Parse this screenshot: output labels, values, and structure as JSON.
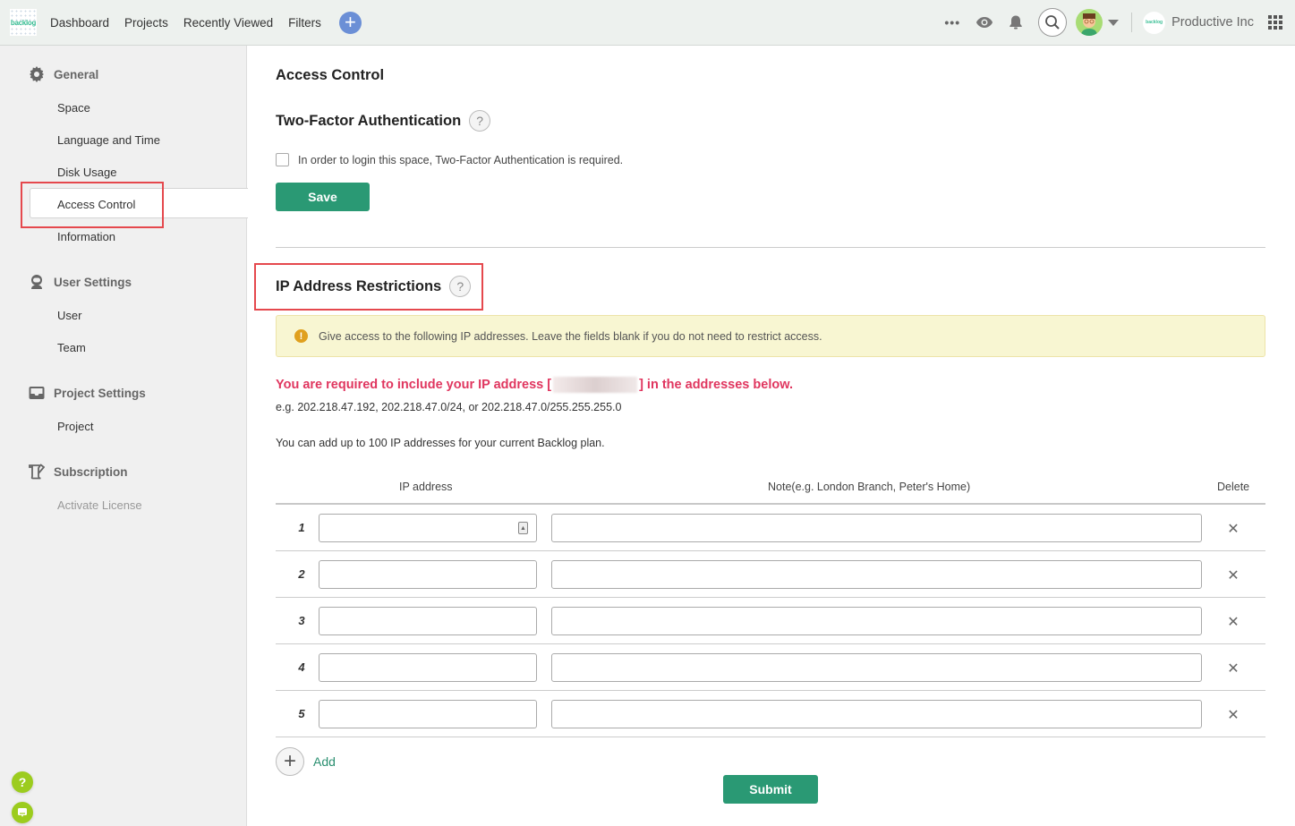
{
  "topbar": {
    "logo_text": "backlog",
    "nav": [
      "Dashboard",
      "Projects",
      "Recently Viewed",
      "Filters"
    ],
    "add_icon": "plus-icon",
    "right_icons": [
      "more-icon",
      "eye-icon",
      "bell-icon",
      "search-icon",
      "avatar",
      "caret-down-icon"
    ],
    "space_logo_text": "backlog",
    "space_name": "Productive Inc",
    "apps_icon": "apps-grid-icon"
  },
  "sidebar": {
    "sections": [
      {
        "title": "General",
        "icon": "gear-icon",
        "items": [
          "Space",
          "Language and Time",
          "Disk Usage",
          "Access Control",
          "Information"
        ]
      },
      {
        "title": "User Settings",
        "icon": "user-icon",
        "items": [
          "User",
          "Team"
        ]
      },
      {
        "title": "Project Settings",
        "icon": "inbox-icon",
        "items": [
          "Project"
        ]
      },
      {
        "title": "Subscription",
        "icon": "scroll-icon",
        "items": [
          "Activate License"
        ]
      }
    ],
    "active_item": "Access Control",
    "help_icon": "?",
    "chat_icon": "chat-icon"
  },
  "main": {
    "title": "Access Control",
    "tfa": {
      "heading": "Two-Factor Authentication",
      "help": "?",
      "checkbox_label": "In order to login this space, Two-Factor Authentication is required.",
      "checked": false,
      "save_label": "Save"
    },
    "ip": {
      "heading": "IP Address Restrictions",
      "help": "?",
      "alert_icon": "!",
      "alert_text": "Give access to the following IP addresses. Leave the fields blank if you do not need to restrict access.",
      "required_prefix": "You are required to include your IP address [",
      "required_suffix": "] in the addresses below.",
      "example": "e.g. 202.218.47.192, 202.218.47.0/24, or 202.218.47.0/255.255.255.0",
      "limit": "You can add up to 100 IP addresses for your current Backlog plan.",
      "columns": {
        "ip": "IP address",
        "note": "Note(e.g. London Branch, Peter's Home)",
        "delete": "Delete"
      },
      "rows": [
        {
          "num": "1",
          "ip": "",
          "note": ""
        },
        {
          "num": "2",
          "ip": "",
          "note": ""
        },
        {
          "num": "3",
          "ip": "",
          "note": ""
        },
        {
          "num": "4",
          "ip": "",
          "note": ""
        },
        {
          "num": "5",
          "ip": "",
          "note": ""
        }
      ],
      "delete_glyph": "✕",
      "add_label": "Add",
      "submit_label": "Submit"
    }
  },
  "colors": {
    "accent_green": "#2a9974",
    "alert_red": "#e0365f",
    "alert_bg": "#f8f6d2",
    "plus_blue": "#6b8fd6",
    "help_green": "#9ccc1e"
  }
}
